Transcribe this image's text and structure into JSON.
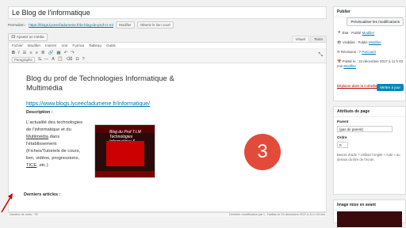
{
  "title_value": "Le Blog de l'informatique",
  "permalink": {
    "label": "Permalien :",
    "url": "https://blogs.lyceecfadumene.fr/le-blog-de-prof-t-i-m/",
    "edit": "Modifier",
    "view": "Obtenir le lien court"
  },
  "media_button": "Ajouter un média",
  "editor_tabs": [
    "Visuel",
    "Texte"
  ],
  "menubar": [
    "Fichier",
    "Modifier",
    "Insérer",
    "Voir",
    "Format",
    "Tableau",
    "Outils"
  ],
  "format_select": "Paragraphe",
  "content": {
    "heading": "Blog du prof de Technologies Informatique & Multimédia",
    "link": "https://www.blogs.lyceecfadumene.fr/informatique/",
    "desc_label": "Description :",
    "body": [
      "L'actualité des technologies de l'informatique et du ",
      "Multimédia",
      " dans l'établissement (Fiches/Tutoriels de cours, lien, vidéos, progressions, ",
      "TICE",
      ", etc.)"
    ],
    "image_title": "Blog du Prof T.I.M",
    "image_subtitle": "Technologies Informatique & Multimédia",
    "recent": "Derniers articles :"
  },
  "badge": "3",
  "status": {
    "words": "Nombre de mots : 78",
    "saved": "Dernière modification par L. Tavitian le 24 décembre 2017 à 11 h 03 min"
  },
  "publish": {
    "title": "Publier",
    "preview": "Prévisualiser les modifications",
    "state": "État : Publié",
    "state_link": "Modifier",
    "visibility": "Visibilité : Publié",
    "visibility_link": "Modifier",
    "revisions": "Révisions : 7",
    "revisions_link": "Parcourir",
    "published": "Publié le : 24 décembre 2017 à 11 h 03 min",
    "published_link": "Modifier",
    "trash": "Déplacer dans la corbeille",
    "update": "Mettre à jour"
  },
  "attributes": {
    "title": "Attributs de page",
    "parent_label": "Parent",
    "parent_value": "(pas de parent)",
    "order_label": "Ordre",
    "order_value": "0",
    "help": "Besoin d'aide ? Utilisez l'onglet « Aide » au dessus du titre de l'écran."
  },
  "featured": {
    "title": "Image mise en avant"
  }
}
